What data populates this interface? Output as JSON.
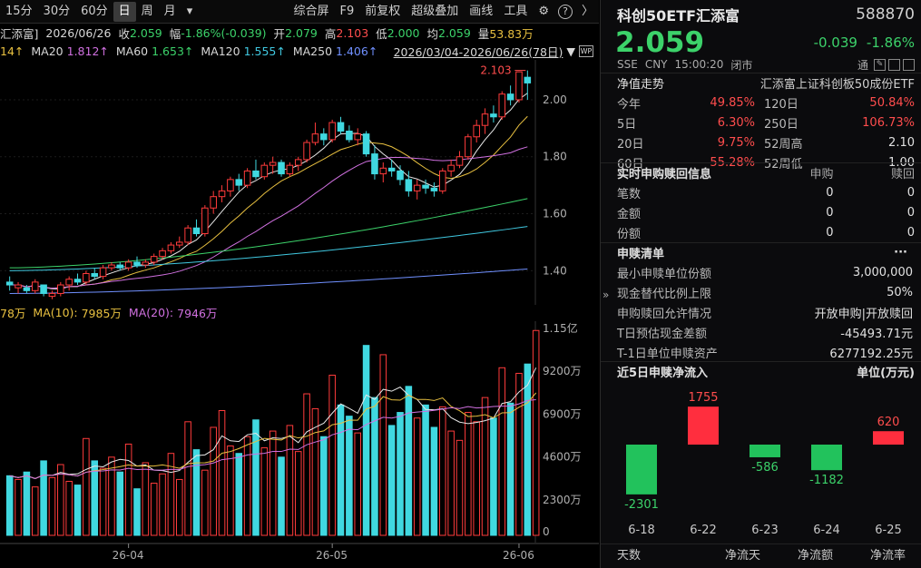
{
  "toolbar": {
    "periods": [
      "15分",
      "30分",
      "60分",
      "日",
      "周",
      "月"
    ],
    "active": "日",
    "more": "▾",
    "tools": [
      "综合屏",
      "F9",
      "前复权",
      "超级叠加",
      "画线",
      "工具"
    ],
    "gear": "⚙",
    "help": "?",
    "arrow": "〉"
  },
  "info1": {
    "name_part": "汇添富]",
    "date": "2026/06/26",
    "close_label": "收",
    "close": "2.059",
    "chg_label": "幅",
    "chg": "-1.86%(-0.039)",
    "open_label": "开",
    "open": "2.079",
    "high_label": "高",
    "high": "2.103",
    "low_label": "低",
    "low": "2.000",
    "avg_label": "均",
    "avg": "2.059",
    "vol_label": "量",
    "vol": "53.83万"
  },
  "info2": {
    "ma_partial": "14↑",
    "ma20_label": "MA20",
    "ma20": "1.812↑",
    "ma60_label": "MA60",
    "ma60": "1.653↑",
    "ma120_label": "MA120",
    "ma120": "1.555↑",
    "ma250_label": "MA250",
    "ma250": "1.406↑",
    "range": "2026/03/04-2026/06/26(78日)"
  },
  "vol_info": {
    "v_partial": "78万",
    "ma10_label": "MA(10):",
    "ma10": "7985万",
    "ma20_label": "MA(20):",
    "ma20": "7946万"
  },
  "chart_data": [
    {
      "type": "candlestick",
      "title": "",
      "yaxis_ticks": [
        "2.00",
        "1.80",
        "1.60",
        "1.40"
      ],
      "ylim": [
        1.28,
        2.14
      ],
      "high_marker": "2.103",
      "ohlc": [
        [
          1.36,
          1.38,
          1.33,
          1.35
        ],
        [
          1.34,
          1.36,
          1.32,
          1.35
        ],
        [
          1.34,
          1.35,
          1.32,
          1.33
        ],
        [
          1.33,
          1.37,
          1.32,
          1.36
        ],
        [
          1.35,
          1.35,
          1.31,
          1.32
        ],
        [
          1.31,
          1.33,
          1.3,
          1.32
        ],
        [
          1.32,
          1.36,
          1.31,
          1.35
        ],
        [
          1.35,
          1.38,
          1.33,
          1.37
        ],
        [
          1.37,
          1.39,
          1.35,
          1.36
        ],
        [
          1.36,
          1.4,
          1.35,
          1.39
        ],
        [
          1.39,
          1.41,
          1.37,
          1.38
        ],
        [
          1.38,
          1.42,
          1.37,
          1.41
        ],
        [
          1.41,
          1.43,
          1.4,
          1.42
        ],
        [
          1.42,
          1.43,
          1.4,
          1.41
        ],
        [
          1.41,
          1.44,
          1.4,
          1.43
        ],
        [
          1.43,
          1.45,
          1.41,
          1.42
        ],
        [
          1.42,
          1.44,
          1.41,
          1.43
        ],
        [
          1.43,
          1.46,
          1.42,
          1.45
        ],
        [
          1.45,
          1.48,
          1.44,
          1.47
        ],
        [
          1.47,
          1.5,
          1.46,
          1.49
        ],
        [
          1.49,
          1.52,
          1.48,
          1.5
        ],
        [
          1.5,
          1.56,
          1.49,
          1.55
        ],
        [
          1.55,
          1.58,
          1.52,
          1.53
        ],
        [
          1.53,
          1.63,
          1.52,
          1.62
        ],
        [
          1.62,
          1.68,
          1.6,
          1.66
        ],
        [
          1.66,
          1.7,
          1.64,
          1.68
        ],
        [
          1.68,
          1.73,
          1.66,
          1.72
        ],
        [
          1.72,
          1.74,
          1.68,
          1.7
        ],
        [
          1.7,
          1.76,
          1.69,
          1.75
        ],
        [
          1.75,
          1.79,
          1.72,
          1.73
        ],
        [
          1.73,
          1.78,
          1.72,
          1.77
        ],
        [
          1.77,
          1.8,
          1.74,
          1.78
        ],
        [
          1.78,
          1.79,
          1.73,
          1.74
        ],
        [
          1.74,
          1.78,
          1.73,
          1.77
        ],
        [
          1.77,
          1.8,
          1.75,
          1.79
        ],
        [
          1.79,
          1.86,
          1.78,
          1.85
        ],
        [
          1.85,
          1.92,
          1.84,
          1.88
        ],
        [
          1.88,
          1.9,
          1.84,
          1.86
        ],
        [
          1.86,
          1.93,
          1.85,
          1.92
        ],
        [
          1.92,
          1.94,
          1.88,
          1.89
        ],
        [
          1.89,
          1.91,
          1.85,
          1.86
        ],
        [
          1.86,
          1.9,
          1.84,
          1.88
        ],
        [
          1.88,
          1.89,
          1.8,
          1.81
        ],
        [
          1.81,
          1.84,
          1.72,
          1.74
        ],
        [
          1.74,
          1.78,
          1.71,
          1.76
        ],
        [
          1.76,
          1.79,
          1.73,
          1.75
        ],
        [
          1.75,
          1.77,
          1.7,
          1.72
        ],
        [
          1.72,
          1.75,
          1.66,
          1.68
        ],
        [
          1.68,
          1.72,
          1.65,
          1.7
        ],
        [
          1.7,
          1.72,
          1.67,
          1.69
        ],
        [
          1.69,
          1.71,
          1.66,
          1.68
        ],
        [
          1.68,
          1.76,
          1.67,
          1.75
        ],
        [
          1.75,
          1.79,
          1.73,
          1.77
        ],
        [
          1.77,
          1.82,
          1.76,
          1.8
        ],
        [
          1.8,
          1.88,
          1.79,
          1.87
        ],
        [
          1.87,
          1.93,
          1.85,
          1.91
        ],
        [
          1.91,
          1.97,
          1.88,
          1.95
        ],
        [
          1.95,
          1.98,
          1.92,
          1.94
        ],
        [
          1.94,
          2.03,
          1.93,
          2.02
        ],
        [
          2.02,
          2.05,
          1.98,
          2.0
        ],
        [
          2.0,
          2.098,
          1.99,
          2.098
        ],
        [
          2.079,
          2.103,
          2.0,
          2.059
        ]
      ]
    },
    {
      "type": "bar",
      "title": "",
      "yaxis_ticks": [
        "1.15亿",
        "9200万",
        "6900万",
        "4600万",
        "2300万",
        "0"
      ],
      "ylim": [
        0,
        11500
      ],
      "values": [
        3200,
        3000,
        3400,
        2600,
        4000,
        3100,
        3800,
        2900,
        2700,
        5200,
        4000,
        3600,
        4200,
        3400,
        4900,
        2500,
        3900,
        2800,
        3300,
        4400,
        3000,
        6100,
        4600,
        3500,
        5800,
        6700,
        4800,
        4400,
        5300,
        6200,
        4700,
        5600,
        4200,
        5900,
        4500,
        7600,
        6800,
        5300,
        8600,
        7000,
        6400,
        5500,
        10200,
        7400,
        9700,
        5900,
        6600,
        8000,
        6300,
        7000,
        5800,
        6900,
        5600,
        5100,
        6600,
        6100,
        7400,
        6300,
        9000,
        7100,
        8700,
        9200,
        11000
      ]
    },
    {
      "type": "bar",
      "title": "近5日申赎净流入",
      "unit": "单位(万元)",
      "categories": [
        "6-18",
        "6-22",
        "6-23",
        "6-24",
        "6-25"
      ],
      "values": [
        -2301,
        1755,
        -586,
        -1182,
        620
      ]
    }
  ],
  "xaxis": {
    "labels": [
      "26-04",
      "26-05",
      "26-06"
    ]
  },
  "right": {
    "title": "科创50ETF汇添富",
    "code": "588870",
    "price": "2.059",
    "chg": "-0.039",
    "pct": "-1.86%",
    "meta": [
      "SSE",
      "CNY",
      "15:00:20",
      "闭市"
    ],
    "tong": "通",
    "nav_label": "净值走势",
    "nav_desc": "汇添富上证科创板50成份ETF",
    "perf": [
      {
        "l1": "今年",
        "v1": "49.85%",
        "l2": "120日",
        "v2": "50.84%"
      },
      {
        "l1": "5日",
        "v1": "6.30%",
        "l2": "250日",
        "v2": "106.73%"
      },
      {
        "l1": "20日",
        "v1": "9.75%",
        "l2": "52周高",
        "v2": "2.10"
      },
      {
        "l1": "60日",
        "v1": "55.28%",
        "l2": "52周低",
        "v2": "1.00"
      }
    ],
    "sub_title": "实时申购赎回信息",
    "sub_col1": "申购",
    "sub_col2": "赎回",
    "sub_rows": [
      {
        "l": "笔数",
        "a": "0",
        "b": "0"
      },
      {
        "l": "金额",
        "a": "0",
        "b": "0"
      },
      {
        "l": "份额",
        "a": "0",
        "b": "0"
      }
    ],
    "list_title": "申赎清单",
    "more": "···",
    "list": [
      {
        "l": "最小申赎单位份额",
        "v": "3,000,000"
      },
      {
        "l": "现金替代比例上限",
        "v": "50%"
      },
      {
        "l": "申购赎回允许情况",
        "v": "开放申购|开放赎回"
      },
      {
        "l": "T日预估现金差额",
        "v": "-45493.71元"
      },
      {
        "l": "T-1日单位申赎资产",
        "v": "6277192.25元"
      }
    ],
    "bottom": [
      "天数",
      "净流天",
      "净流额",
      "净流率"
    ]
  }
}
